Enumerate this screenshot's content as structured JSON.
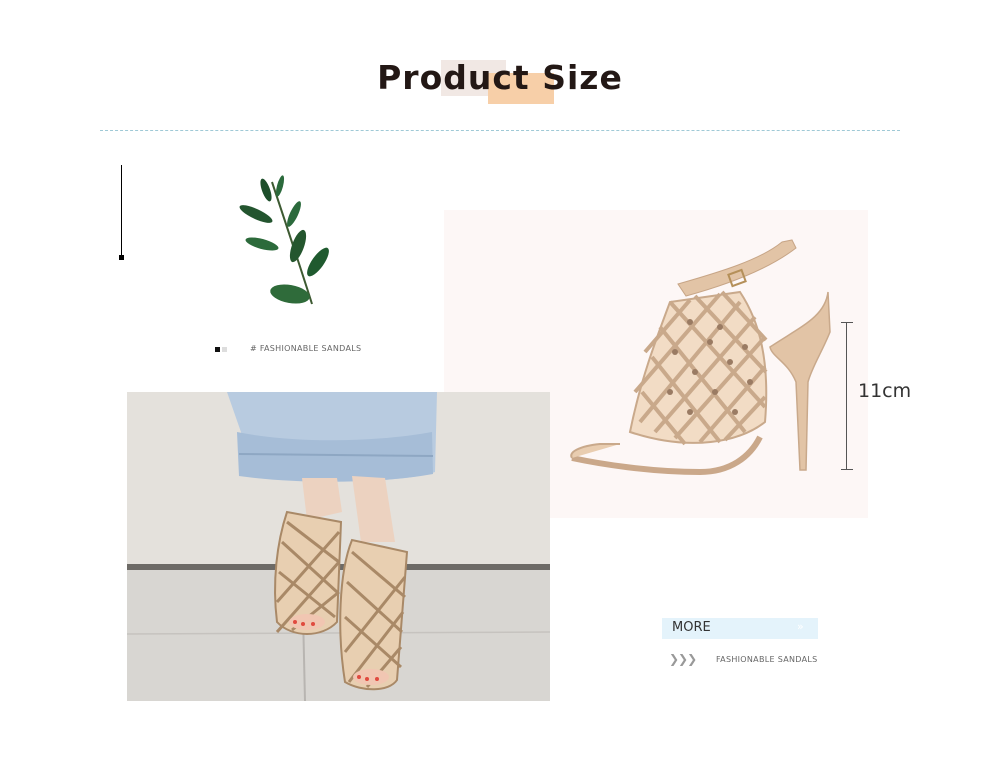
{
  "header": {
    "title": "Product Size"
  },
  "leaf_section": {
    "tag_label": "# FASHIONABLE SANDALS"
  },
  "product": {
    "height_label": "11cm"
  },
  "more": {
    "label": "MORE",
    "arrow": "»",
    "chevrons": "❯❯❯",
    "sub_label": "FASHIONABLE SANDALS"
  },
  "colors": {
    "title": "#231815",
    "accent_beige": "#f7cfa8",
    "more_bg": "#e4f3fb",
    "divider": "#9fc9d6"
  }
}
